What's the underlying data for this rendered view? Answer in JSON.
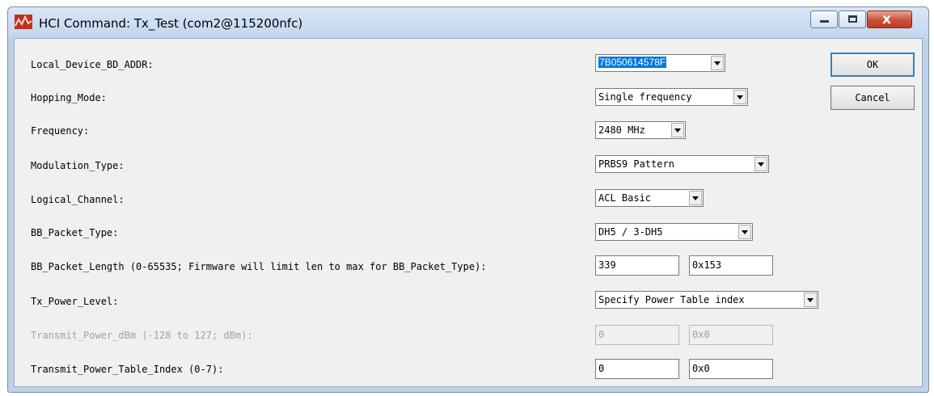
{
  "window": {
    "title": "HCI Command: Tx_Test (com2@115200nfc)",
    "close_glyph": "x",
    "app_icon": "red-chart-icon"
  },
  "fields": {
    "local_device_bd_addr": {
      "label": "Local_Device_BD_ADDR:",
      "value": "7B050614578F"
    },
    "hopping_mode": {
      "label": "Hopping_Mode:",
      "value": "Single frequency"
    },
    "frequency": {
      "label": "Frequency:",
      "value": "2480 MHz"
    },
    "modulation_type": {
      "label": "Modulation_Type:",
      "value": "PRBS9 Pattern"
    },
    "logical_channel": {
      "label": "Logical_Channel:",
      "value": "ACL Basic"
    },
    "bb_packet_type": {
      "label": "BB_Packet_Type:",
      "value": "DH5 / 3-DH5"
    },
    "bb_packet_length": {
      "label": "BB_Packet_Length (0-65535; Firmware will limit len to max for BB_Packet_Type):",
      "value": "339",
      "hex": "0x153"
    },
    "tx_power_level": {
      "label": "Tx_Power_Level:",
      "value": "Specify Power Table index"
    },
    "transmit_power_dbm": {
      "label": "Transmit_Power_dBm (-128 to 127; dBm):",
      "value": "0",
      "hex": "0x0"
    },
    "transmit_power_table_index": {
      "label": "Transmit_Power_Table_Index (0-7):",
      "value": "0",
      "hex": "0x0"
    }
  },
  "buttons": {
    "ok": "OK",
    "cancel": "Cancel"
  },
  "colors": {
    "selection": "#0078d7",
    "close_button": "#c85038",
    "disabled_text": "#a0a0a0"
  }
}
